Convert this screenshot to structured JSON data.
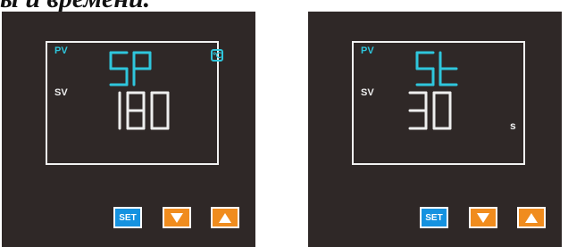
{
  "caption": "ы и времени.",
  "colors": {
    "panel": "#2f2827",
    "pv": "#2fc6dc",
    "sv": "#eeeeee",
    "set_button": "#1592e0",
    "arrow_button": "#f08c1e"
  },
  "panels": [
    {
      "pv_label": "PV",
      "sv_label": "SV",
      "pv_display": "SP",
      "sv_display": "180",
      "unit_badge": "℃",
      "unit_text": "",
      "buttons": {
        "set": "SET",
        "down_icon": "down-triangle-icon",
        "up_icon": "up-triangle-icon"
      }
    },
    {
      "pv_label": "PV",
      "sv_label": "SV",
      "pv_display": "St",
      "sv_display": "30",
      "unit_badge": "",
      "unit_text": "s",
      "buttons": {
        "set": "SET",
        "down_icon": "down-triangle-icon",
        "up_icon": "up-triangle-icon"
      }
    }
  ]
}
